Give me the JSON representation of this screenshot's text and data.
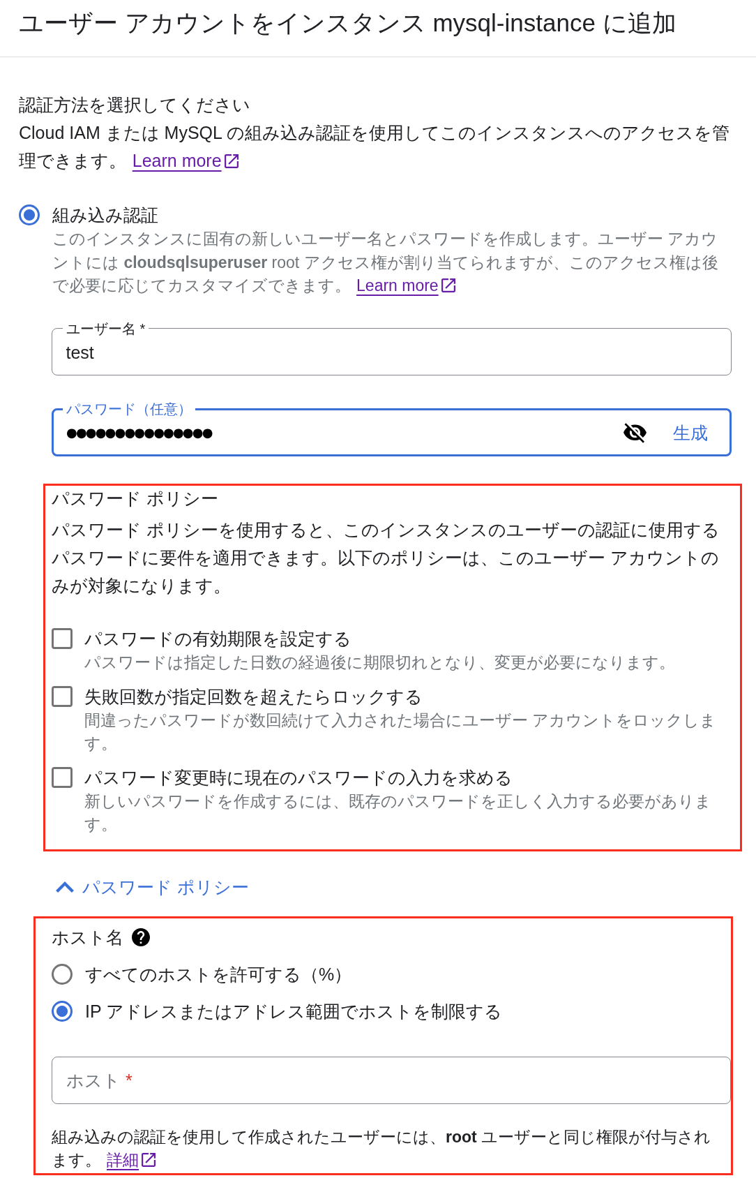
{
  "dialog": {
    "title": "ユーザー アカウントをインスタンス mysql-instance に追加"
  },
  "authentication": {
    "heading": "認証方法を選択してください",
    "description": "Cloud IAM または MySQL の組み込み認証を使用してこのインスタンスへのアクセスを管理できます。",
    "link": "Learn more",
    "options": [
      {
        "label": "組み込み認証",
        "selected": true,
        "description": "このインスタンスに固有の新しいユーザー名とパスワードを作成します。ユーザー アカウントには **cloudsqlsuperuser** root アクセス権が割り当てられますが、このアクセス権は後で必要に応じてカスタマイズできます。",
        "link": "Learn more"
      }
    ]
  },
  "username_field": {
    "label": "ユーザー名",
    "required_mark": "*",
    "value": "test",
    "focused": false
  },
  "password_field": {
    "label": "パスワード（任意）",
    "value": "●●●●●●●●●●●●●●●",
    "focused": true,
    "value_visible": false,
    "action": "生成"
  },
  "password_policy": {
    "highlighted": true,
    "heading": "パスワード ポリシー",
    "description": "パスワード ポリシーを使用すると、このインスタンスのユーザーの認証に使用するパスワードに要件を適用できます。以下のポリシーは、このユーザー アカウントのみが対象になります。",
    "options": [
      {
        "label": "パスワードの有効期限を設定する",
        "checked": false,
        "description": "パスワードは指定した日数の経過後に期限切れとなり、変更が必要になります。"
      },
      {
        "label": "失敗回数が指定回数を超えたらロックする",
        "checked": false,
        "description": "間違ったパスワードが数回続けて入力された場合にユーザー アカウントをロックします。"
      },
      {
        "label": "パスワード変更時に現在のパスワードの入力を求める",
        "checked": false,
        "description": "新しいパスワードを作成するには、既存のパスワードを正しく入力する必要があります。"
      }
    ]
  },
  "policy_toggle": {
    "label": "パスワード ポリシー",
    "expanded": true
  },
  "host": {
    "highlighted": true,
    "heading": "ホスト名",
    "options": [
      {
        "label": "すべてのホストを許可する（%）",
        "selected": false
      },
      {
        "label": "IP アドレスまたはアドレス範囲でホストを制限する",
        "selected": true
      }
    ],
    "field": {
      "label": "ホスト",
      "required_mark": "*",
      "focused": false
    },
    "note": "組み込みの認証を使用して作成されたユーザーには、**root** ユーザーと同じ権限が付与されます。",
    "link": "詳細"
  }
}
